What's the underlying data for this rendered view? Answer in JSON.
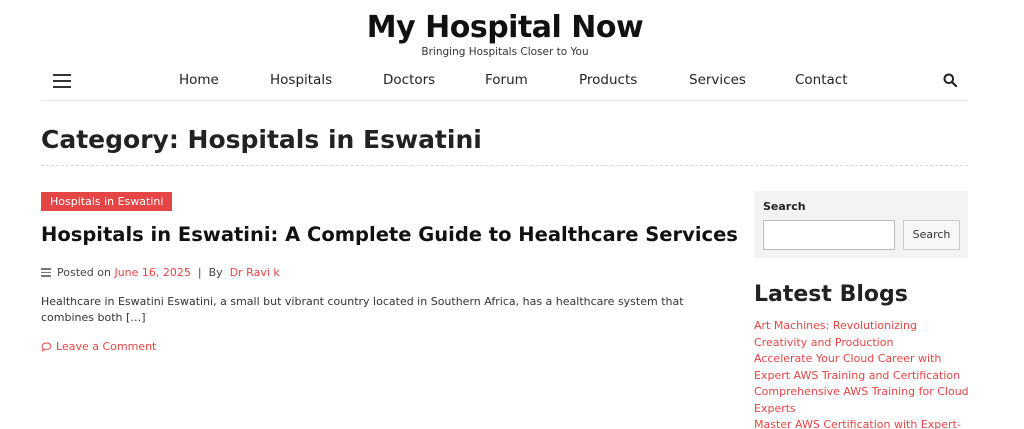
{
  "site": {
    "title": "My Hospital Now",
    "tagline": "Bringing Hospitals Closer to You"
  },
  "nav": {
    "items": [
      "Home",
      "Hospitals",
      "Doctors",
      "Forum",
      "Products",
      "Services",
      "Contact"
    ],
    "menu_icon": "hamburger-icon",
    "search_icon": "search-icon"
  },
  "archive": {
    "title": "Category: Hospitals in Eswatini"
  },
  "post": {
    "category": "Hospitals in Eswatini",
    "title": "Hospitals in Eswatini: A Complete Guide to Healthcare Services",
    "posted_on_label": "Posted on",
    "date": "June 16, 2025",
    "separator": "|",
    "by_label": "By",
    "author": "Dr Ravi k",
    "excerpt": "Healthcare in Eswatini Eswatini, a small but vibrant country located in Southern Africa, has a healthcare system that combines both […]",
    "comment_link": "Leave a Comment"
  },
  "sidebar": {
    "search": {
      "label": "Search",
      "placeholder": "",
      "button": "Search"
    },
    "latest": {
      "title": "Latest Blogs",
      "items": [
        "Art Machines: Revolutionizing Creativity and Production",
        "Accelerate Your Cloud Career with Expert AWS Training and Certification",
        "Comprehensive AWS Training for Cloud Experts",
        "Master AWS Certification with Expert-"
      ]
    }
  },
  "colors": {
    "accent": "#e64545",
    "text": "#222222",
    "widget_bg": "#f3f3f3"
  }
}
